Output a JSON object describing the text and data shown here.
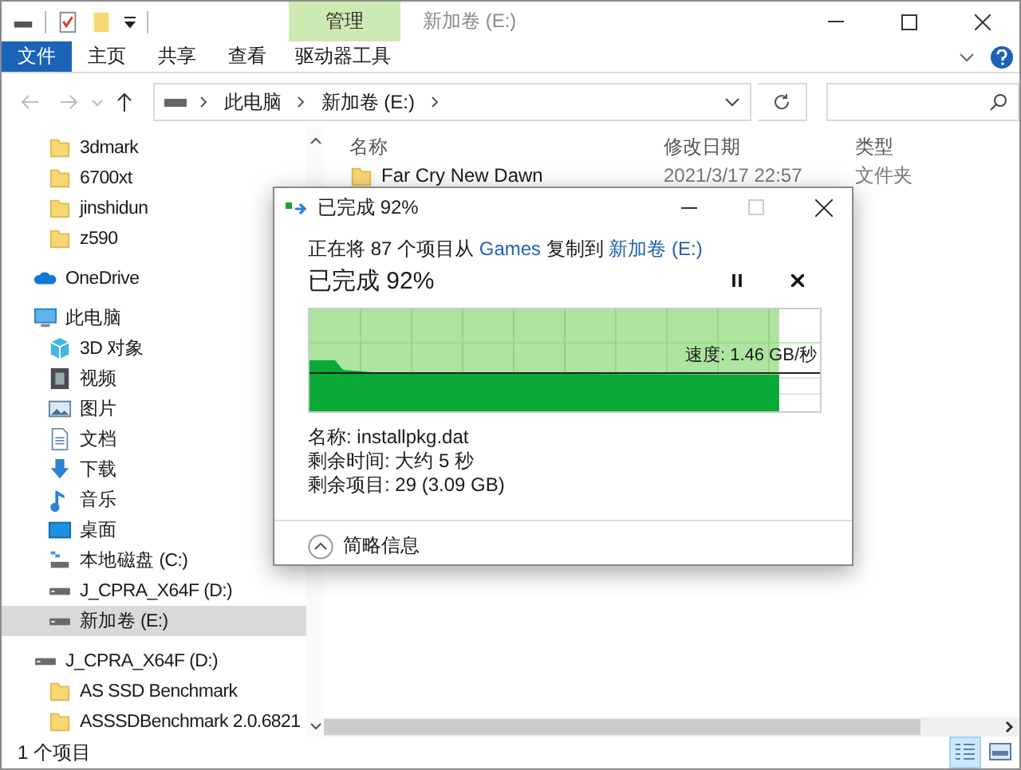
{
  "title_bar": {
    "contextual_tab": "管理",
    "title": "新加卷 (E:)"
  },
  "ribbon": {
    "file_tab": "文件",
    "tabs": [
      "主页",
      "共享",
      "查看"
    ],
    "contextual_tool_tab": "驱动器工具"
  },
  "address": {
    "crumbs": [
      "此电脑",
      "新加卷 (E:)"
    ]
  },
  "sidebar": {
    "quick_access": [
      {
        "label": "3dmark",
        "kind": "folder",
        "selected": false
      },
      {
        "label": "6700xt",
        "kind": "folder",
        "selected": false
      },
      {
        "label": "jinshidun",
        "kind": "folder",
        "selected": false
      },
      {
        "label": "z590",
        "kind": "folder",
        "selected": false
      }
    ],
    "tree": [
      {
        "label": "OneDrive",
        "kind": "cloud",
        "selected": false
      },
      {
        "label": "此电脑",
        "kind": "pc",
        "selected": false,
        "children": [
          {
            "label": "3D 对象",
            "kind": "cube",
            "selected": false
          },
          {
            "label": "视频",
            "kind": "video",
            "selected": false
          },
          {
            "label": "图片",
            "kind": "picture",
            "selected": false
          },
          {
            "label": "文档",
            "kind": "document",
            "selected": false
          },
          {
            "label": "下载",
            "kind": "download",
            "selected": false
          },
          {
            "label": "音乐",
            "kind": "music",
            "selected": false
          },
          {
            "label": "桌面",
            "kind": "desktop",
            "selected": false
          },
          {
            "label": "本地磁盘 (C:)",
            "kind": "system-drive",
            "selected": false
          },
          {
            "label": "J_CPRA_X64F (D:)",
            "kind": "drive",
            "selected": false
          },
          {
            "label": "新加卷 (E:)",
            "kind": "drive",
            "selected": true
          }
        ]
      },
      {
        "label": "J_CPRA_X64F (D:)",
        "kind": "drive",
        "selected": false,
        "children": [
          {
            "label": "AS SSD Benchmark",
            "kind": "folder",
            "selected": false
          },
          {
            "label": "ASSSDBenchmark 2.0.6821",
            "kind": "folder",
            "selected": false
          }
        ]
      }
    ]
  },
  "file_list": {
    "columns": [
      "名称",
      "修改日期",
      "类型"
    ],
    "rows": [
      {
        "name": "Far Cry New Dawn",
        "modified": "2021/3/17 22:57",
        "type": "文件夹"
      }
    ]
  },
  "copy_dialog": {
    "title": "已完成 92%",
    "summary": [
      {
        "kind": "text",
        "text": "正在将 87 个项目从 "
      },
      {
        "kind": "link",
        "text": "Games"
      },
      {
        "kind": "text",
        "text": " 复制到 "
      },
      {
        "kind": "link",
        "text": "新加卷 (E:)"
      }
    ],
    "heading": "已完成 92%",
    "progress": {
      "level": 0.92
    },
    "speed": "速度: 1.46 GB/秒",
    "details": [
      "名称: installpkg.dat",
      "剩余时间: 大约 5 秒",
      "剩余项目: 29 (3.09 GB)"
    ],
    "toggle": "简略信息"
  },
  "status_bar": {
    "item_count": "1 个项目",
    "views": [
      {
        "kind": "details",
        "selected": true
      },
      {
        "kind": "tiles",
        "selected": false
      }
    ]
  }
}
